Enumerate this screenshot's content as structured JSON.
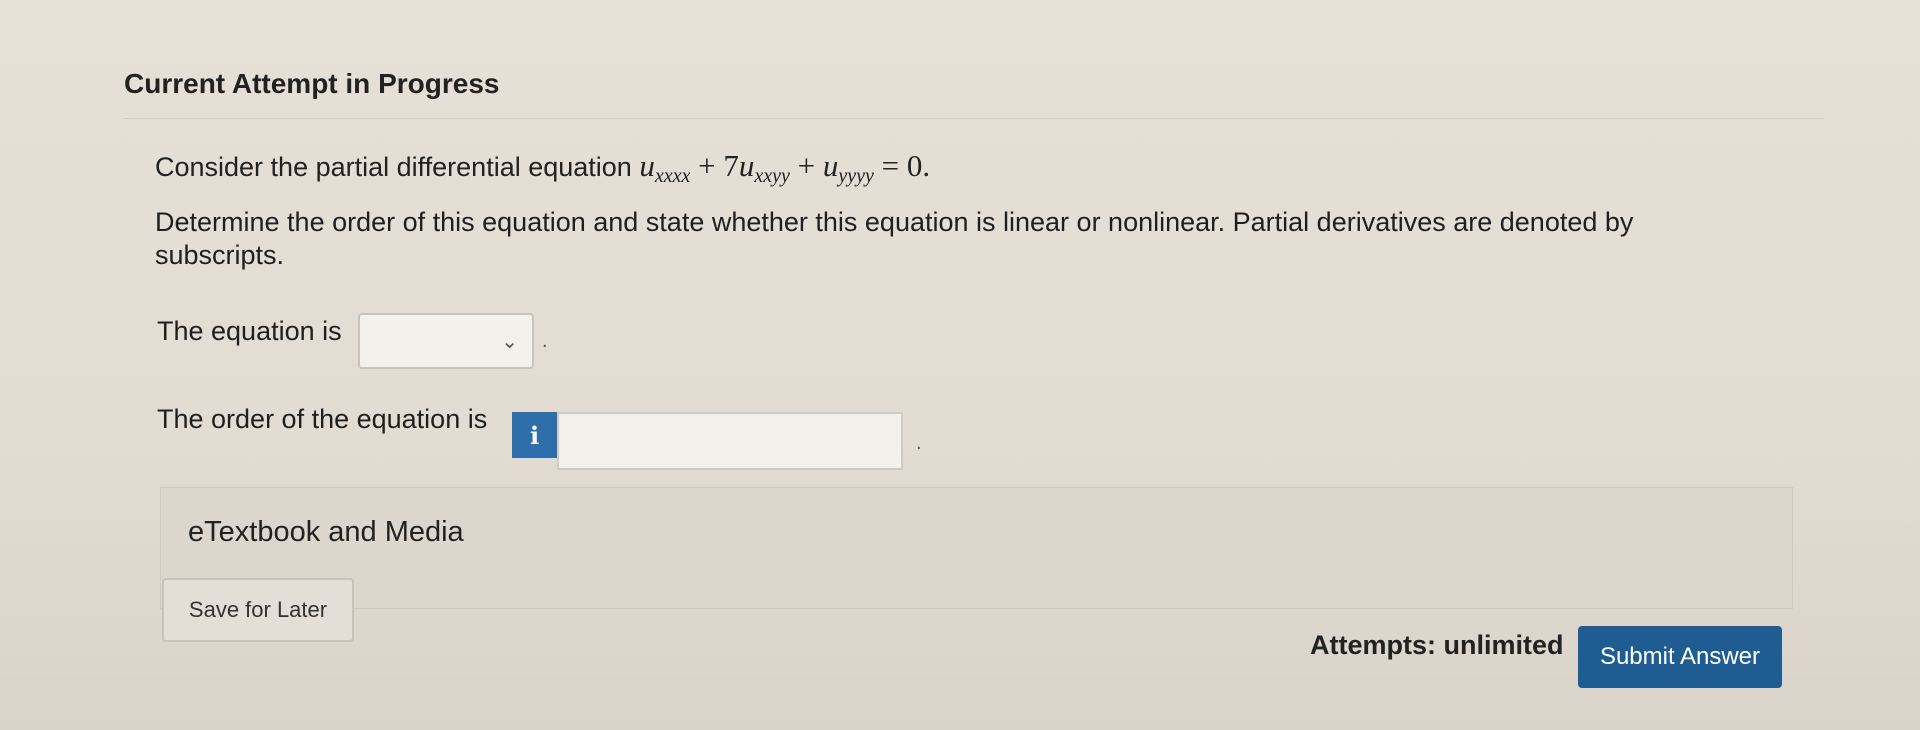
{
  "header": {
    "title": "Current Attempt in Progress"
  },
  "question": {
    "intro": "Consider the partial differential equation",
    "equation": {
      "t1_base": "u",
      "t1_sub": "xxxx",
      "plus1": "+",
      "t2_coef": "7",
      "t2_base": "u",
      "t2_sub": "xxyy",
      "plus2": "+",
      "t3_base": "u",
      "t3_sub": "yyyy",
      "rhs": "= 0."
    },
    "prompt": "Determine the order of this equation and state whether this equation is linear or nonlinear. Partial derivatives are denoted by subscripts."
  },
  "form": {
    "linearity_label": "The equation is",
    "linearity_value": "",
    "order_label": "The order of the equation is",
    "order_value": "",
    "info_icon": "i",
    "period": "."
  },
  "media": {
    "label": "eTextbook and Media"
  },
  "footer": {
    "save_label": "Save for Later",
    "attempts": "Attempts: unlimited",
    "submit_label": "Submit Answer"
  },
  "colors": {
    "info": "#2e6fab",
    "submit": "#1f5c91"
  }
}
